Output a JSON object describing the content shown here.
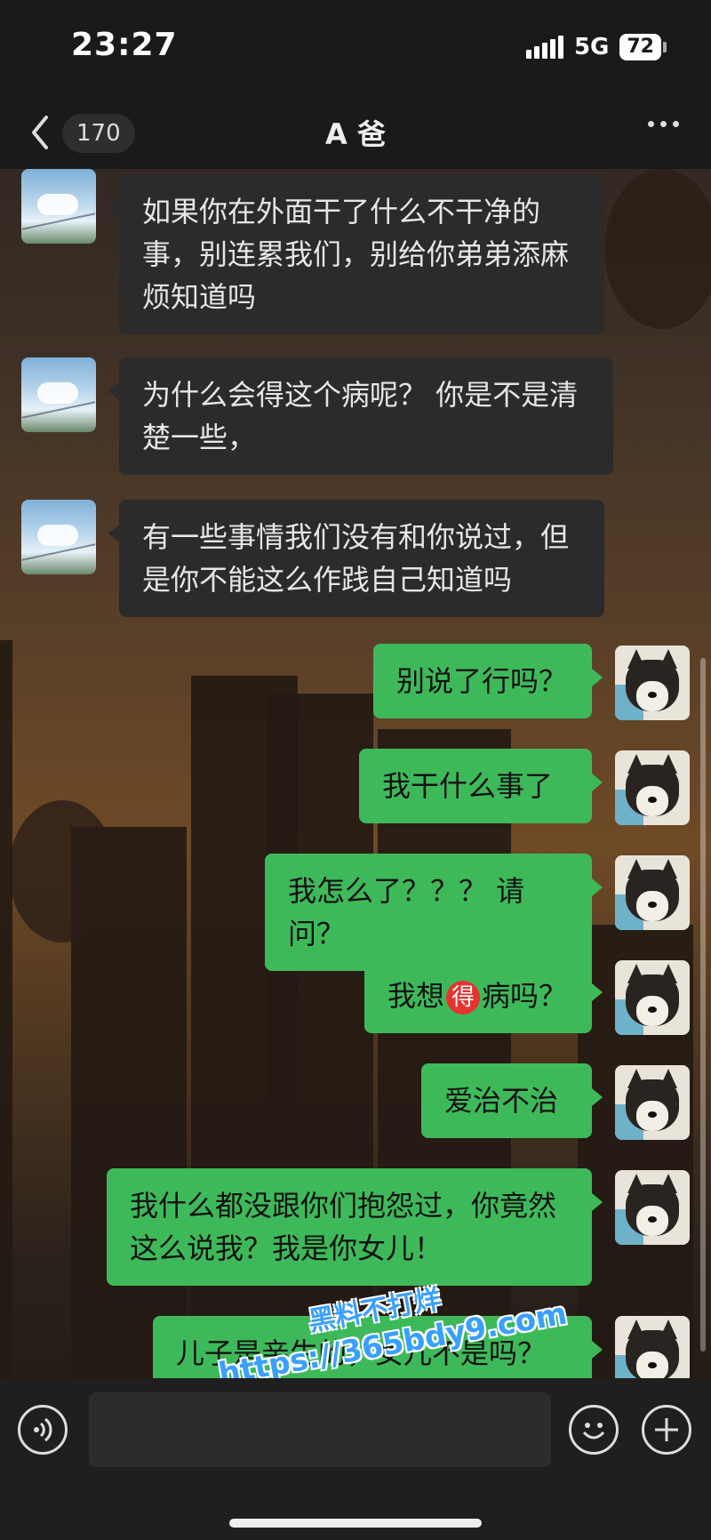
{
  "status_bar": {
    "time": "23:27",
    "network": "5G",
    "battery": "72"
  },
  "nav": {
    "unread_count": "170",
    "title": "A 爸"
  },
  "messages": [
    {
      "side": "in",
      "text": "如果你在外面干了什么不干净的事，别连累我们，别给你弟弟添麻烦知道吗",
      "avatar": "sky-avatar"
    },
    {
      "side": "in",
      "text": "为什么会得这个病呢？ 你是不是清楚一些，",
      "avatar": "sky-avatar"
    },
    {
      "side": "in",
      "text": "有一些事情我们没有和你说过，但是你不能这么作践自己知道吗",
      "avatar": "sky-avatar"
    },
    {
      "side": "out",
      "text": "别说了行吗？",
      "avatar": "shiba-avatar"
    },
    {
      "side": "out",
      "text": "我干什么事了",
      "avatar": "shiba-avatar"
    },
    {
      "side": "out",
      "text": "我怎么了？？？ 请问？",
      "avatar": "shiba-avatar"
    },
    {
      "side": "out",
      "text_before": "我想",
      "emoji_char": "得",
      "text_after": "病吗？",
      "avatar": "shiba-avatar"
    },
    {
      "side": "out",
      "text": "爱治不治",
      "avatar": "shiba-avatar"
    },
    {
      "side": "out",
      "text": "我什么都没跟你们抱怨过，你竟然这么说我？我是你女儿！",
      "avatar": "shiba-avatar"
    },
    {
      "side": "out",
      "text": "儿子是亲生的，女儿不是吗？",
      "avatar": "shiba-avatar"
    }
  ],
  "watermark": {
    "line1": "黑料不打烊",
    "line2": "https://365bdy9.com"
  },
  "input": {
    "value": ""
  },
  "colors": {
    "outgoing_bubble": "#3eb95a",
    "incoming_bubble": "#2b2b2b",
    "bar": "#1a1a1a"
  }
}
